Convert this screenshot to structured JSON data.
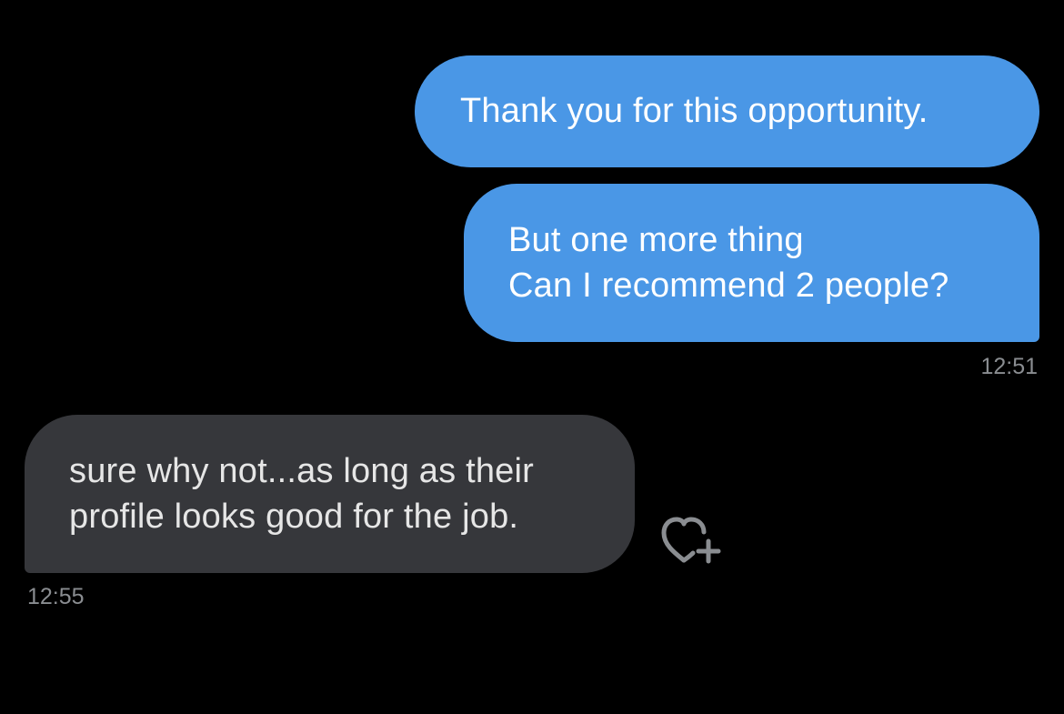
{
  "conversation": {
    "messages": [
      {
        "direction": "outgoing",
        "lines": [
          "Thank you for this opportunity."
        ]
      },
      {
        "direction": "outgoing",
        "lines": [
          "But one more thing",
          "Can I recommend 2 people?"
        ],
        "timestamp": "12:51"
      },
      {
        "direction": "incoming",
        "lines": [
          "sure why not...as long as their",
          "profile looks good for the job."
        ],
        "timestamp": "12:55"
      }
    ]
  },
  "icons": {
    "reaction": "heart-plus-icon"
  },
  "colors": {
    "background": "#000000",
    "outgoing_bubble": "#4a97e6",
    "incoming_bubble": "#36373b",
    "timestamp": "#8a8d91"
  }
}
